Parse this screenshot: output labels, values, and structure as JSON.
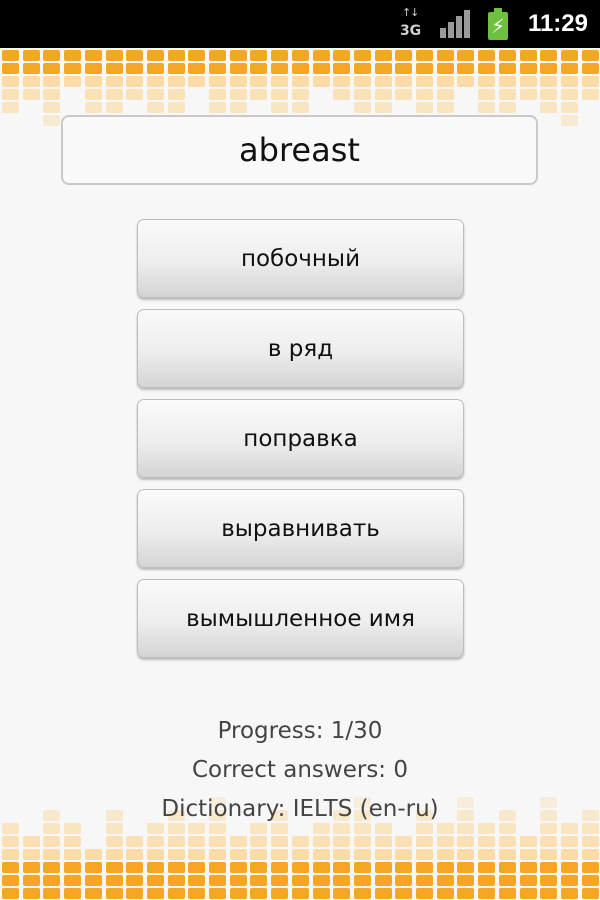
{
  "status_bar": {
    "network_label": "3G",
    "network_arrows": "↑↓",
    "time": "11:29"
  },
  "colors": {
    "accent_orange": "#f5a623",
    "light_orange": "#fbd79a",
    "battery_green": "#6ec13e"
  },
  "quiz": {
    "word": "abreast",
    "answers": [
      "побочный",
      "в ряд",
      "поправка",
      "выравнивать",
      "вымышленное имя"
    ]
  },
  "stats": {
    "progress": "Progress: 1/30",
    "correct": "Correct answers: 0",
    "dictionary": "Dictionary: IELTS (en-ru)"
  }
}
